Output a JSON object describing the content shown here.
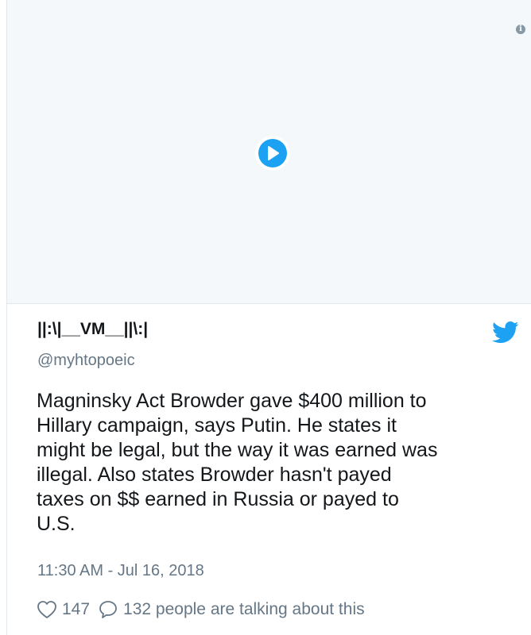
{
  "media": {
    "play_icon": "play-icon",
    "info_icon": "info-icon",
    "info_glyph": "i"
  },
  "author": {
    "name": "||:\\|__VM__||\\:|",
    "handle": "@myhtopoeic"
  },
  "brand": {
    "icon": "twitter-bird-icon",
    "color": "#1da1f2"
  },
  "tweet": {
    "text": "Magninsky Act Browder gave $400 million to\nHillary campaign, says Putin. He states it\nmight be legal, but the way it was earned was\nillegal. Also states Browder hasn't payed\ntaxes on $$ earned in Russia or payed to\nU.S.",
    "timestamp": "11:30 AM - Jul 16, 2018"
  },
  "actions": {
    "like_count": "147",
    "talking_text": "132 people are talking about this"
  }
}
